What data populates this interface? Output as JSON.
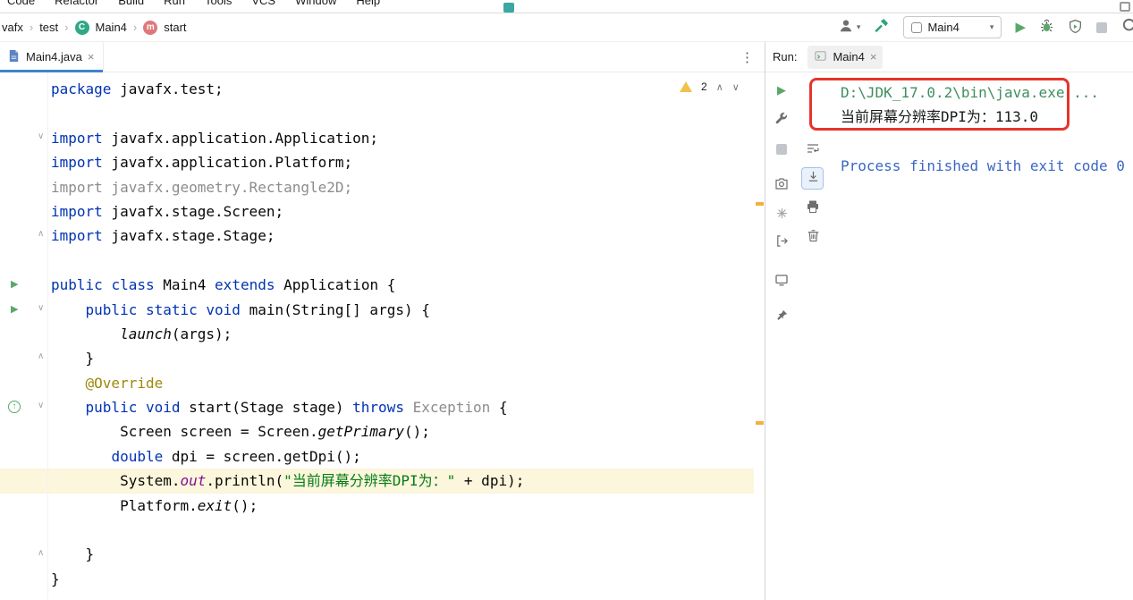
{
  "menubar": {
    "items": [
      "Code",
      "Refactor",
      "Build",
      "Run",
      "Tools",
      "VCS",
      "Window",
      "Help"
    ]
  },
  "breadcrumbs": {
    "items": [
      {
        "label": "vafx"
      },
      {
        "label": "test"
      },
      {
        "label": "Main4",
        "icon": "C"
      },
      {
        "label": "start",
        "icon": "m"
      }
    ]
  },
  "nav_toolbar": {
    "run_config": "Main4"
  },
  "editor_tabs": {
    "active": "Main4.java"
  },
  "run_panel": {
    "label": "Run:",
    "tab": "Main4"
  },
  "inspections": {
    "warning_count": "2"
  },
  "icons": {
    "play": "▶",
    "stop": "■",
    "close": "×",
    "kebab": "⋮",
    "chevron_up": "∧",
    "chevron_down": "∨",
    "dropdown": "▾",
    "separator": "›",
    "run_line": "▶",
    "fold_down": "∨",
    "fold_up": "∧",
    "override_arrow": "↑"
  },
  "colors": {
    "keyword_blue": "#0033B3",
    "string_green": "#067D17",
    "annotation_olive": "#9E880D",
    "unused_gray": "#8C8C8C",
    "field_purple": "#871094",
    "run_green": "#59A869",
    "warning_yellow": "#F0C24B",
    "caret_row_yellow": "#FBF6DC",
    "annotation_red": "#E5352B",
    "console_command_green": "#3E8E5E",
    "console_system_blue": "#3B66C4",
    "tab_underline_blue": "#4083C9"
  },
  "editor": {
    "lines": [
      {
        "t": [
          [
            "k",
            "package"
          ],
          [
            "d",
            " javafx.test;"
          ]
        ]
      },
      {
        "t": []
      },
      {
        "t": [
          [
            "k",
            "import"
          ],
          [
            "d",
            " javafx.application.Application;"
          ]
        ]
      },
      {
        "t": [
          [
            "k",
            "import"
          ],
          [
            "d",
            " javafx.application.Platform;"
          ]
        ]
      },
      {
        "t": [
          [
            "g",
            "import javafx.geometry.Rectangle2D;"
          ]
        ]
      },
      {
        "t": [
          [
            "k",
            "import"
          ],
          [
            "d",
            " javafx.stage.Screen;"
          ]
        ]
      },
      {
        "t": [
          [
            "k",
            "import"
          ],
          [
            "d",
            " javafx.stage.Stage;"
          ]
        ]
      },
      {
        "t": []
      },
      {
        "t": [
          [
            "k",
            "public"
          ],
          [
            "d",
            " "
          ],
          [
            "k",
            "class"
          ],
          [
            "d",
            " Main4 "
          ],
          [
            "k",
            "extends"
          ],
          [
            "d",
            " Application {"
          ]
        ]
      },
      {
        "t": [
          [
            "d",
            "    "
          ],
          [
            "k",
            "public"
          ],
          [
            "d",
            " "
          ],
          [
            "k",
            "static"
          ],
          [
            "d",
            " "
          ],
          [
            "k",
            "void"
          ],
          [
            "d",
            " main(String[] args) {"
          ]
        ]
      },
      {
        "t": [
          [
            "d",
            "        "
          ],
          [
            "im",
            "launch"
          ],
          [
            "d",
            "(args);"
          ]
        ]
      },
      {
        "t": [
          [
            "d",
            "    }"
          ]
        ]
      },
      {
        "t": [
          [
            "a",
            "    @Override"
          ]
        ]
      },
      {
        "t": [
          [
            "d",
            "    "
          ],
          [
            "k",
            "public"
          ],
          [
            "d",
            " "
          ],
          [
            "k",
            "void"
          ],
          [
            "d",
            " start(Stage stage) "
          ],
          [
            "k",
            "throws"
          ],
          [
            "d",
            " "
          ],
          [
            "g",
            "Exception"
          ],
          [
            "d",
            " {"
          ]
        ]
      },
      {
        "t": [
          [
            "d",
            "        Screen screen = Screen."
          ],
          [
            "im",
            "getPrimary"
          ],
          [
            "d",
            "();"
          ]
        ]
      },
      {
        "t": [
          [
            "d",
            "       "
          ],
          [
            "k",
            "double"
          ],
          [
            "d",
            " dpi = screen.getDpi();"
          ]
        ]
      },
      {
        "hl": true,
        "t": [
          [
            "d",
            "        System."
          ],
          [
            "fo",
            "out"
          ],
          [
            "d",
            ".println("
          ],
          [
            "s",
            "\"当前屏幕分辨率DPI为：\""
          ],
          [
            "d",
            " + dpi);"
          ]
        ]
      },
      {
        "t": [
          [
            "d",
            "        Platform."
          ],
          [
            "im",
            "exit"
          ],
          [
            "d",
            "();"
          ]
        ]
      },
      {
        "t": []
      },
      {
        "t": [
          [
            "d",
            "    }"
          ]
        ]
      },
      {
        "t": [
          [
            "d",
            "}"
          ]
        ]
      }
    ],
    "gutter": [
      {
        "line": 3,
        "type": "fold-down"
      },
      {
        "line": 7,
        "type": "fold-up"
      },
      {
        "line": 9,
        "type": "run"
      },
      {
        "line": 10,
        "type": "run"
      },
      {
        "line": 10,
        "type": "fold-down"
      },
      {
        "line": 12,
        "type": "fold-up"
      },
      {
        "line": 14,
        "type": "override"
      },
      {
        "line": 14,
        "type": "fold-down"
      },
      {
        "line": 20,
        "type": "fold-up"
      }
    ]
  },
  "console": {
    "lines": [
      {
        "style": "cmd",
        "text": "D:\\JDK_17.0.2\\bin\\java.exe ..."
      },
      {
        "style": "plain",
        "text": "当前屏幕分辨率DPI为：113.0"
      },
      {
        "style": "plain",
        "text": ""
      },
      {
        "style": "sys",
        "text": "Process finished with exit code 0"
      }
    ]
  }
}
